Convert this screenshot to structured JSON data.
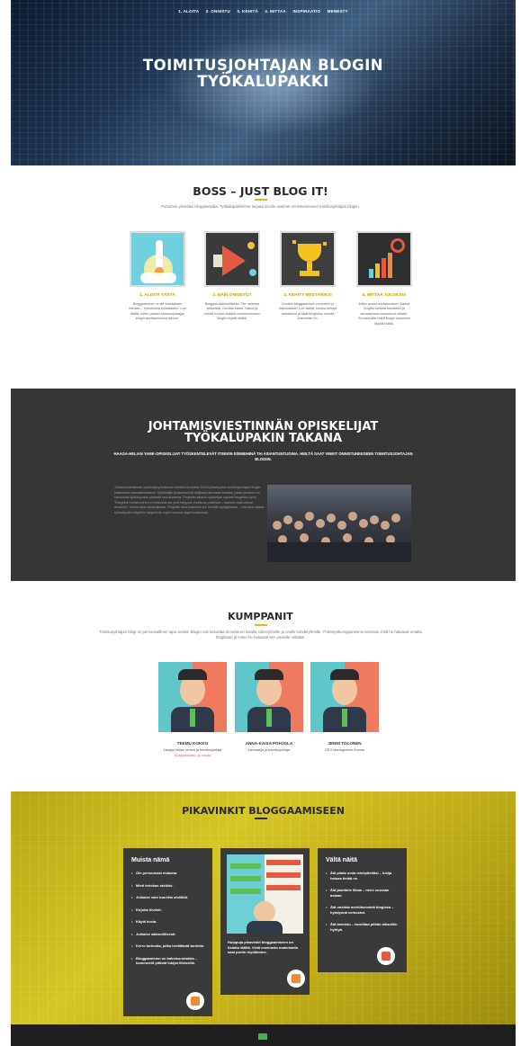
{
  "nav": [
    "1. ALOITA",
    "2. ONNISTU",
    "3. KEHITÄ",
    "4. MITTAA",
    "INSPIRAATIO",
    "MENESTY"
  ],
  "hero": {
    "title_line1": "TOIMITUSJOHTAJAN BLOGIN",
    "title_line2": "TYÖKALUPAKKI"
  },
  "boss": {
    "title": "BOSS – JUST BLOG IT!",
    "subtitle": "Puhuttele yleisöäsi bloggaamalla. Työkalupakkimme tarjoaa sinulle avaimet onnistuneeseen toimitusjohtajan blogiin."
  },
  "tools": [
    {
      "title": "1. ALOITA TÄSTÄ",
      "icon": "rocket-icon",
      "desc": "Bloggaaminen ei ole sosiaalisen median – työkaluista kohtalainen. Lue täältä, miten pääset toimitusjohtajan blogin aloittamisessa alkuun."
    },
    {
      "title": "2. NÄIN ONNISTUT",
      "icon": "megaphone-icon",
      "desc": "Bloggaa säännöllisesti. Tee rakenne selkeäksi. Kuvitus tukee. Nämä ja monta muuta vinkkiä onnistuneeseen blogiin löydät täältä."
    },
    {
      "title": "3. KEHITY MESTARIKSI",
      "icon": "trophy-icon",
      "desc": "Onnistu bloggaamisen perusteet jo hallinnassa? Lue täältä, kuinka kehityt mestariksi ja saat blogistasi entistä enemmän irti."
    },
    {
      "title": "4. MITTAA TULOKSIA",
      "icon": "chart-icon",
      "desc": "Miten arvioit onnistumista? Kaava blogille selkeät tavoitteet ja seuraamaan avainluvut mitatut. Seuraavalla vinkit blogin arvioimiin löydät täältä."
    }
  ],
  "students": {
    "title_line1": "JOHTAMISVIESTINNÄN OPISKELIJAT",
    "title_line2": "TYÖKALUPAKIN TAKANA",
    "subtitle": "HAAGA-HELIAN YAMK-OPISKELIJAT TYÖSKENTELEVÄT ITSEKIN ESIMIEHINÄ TAI ASIANTUNTIJOINA. HEILTÄ SAAT VINKIT ONNISTUNEESEEN TOIMITUSJOHTAJAN BLOGIIN.",
    "text": "Johtamisviestinnän opiskelijaryhmämme kehitteli keväällä 2019 työkalupakin toimitusjohtajan blogin pitämiseen ammattimaisesti. Opiskelijat työskentelivät neljässä pienessä tiimissä, joista jokainen oli vastuussa työkalupakin yhdestä osa-alueesta. Projektin aikana opiskelijat oppivat blogeista hyvin. \"Blogeihin tutustuminen ei hetkessä ole yhtä helppoa, mutta se palkitsee – tuleekin siitä vaivan arvoinen\", kertoo yksi opiskelijoista. Projektin idea kuitenkin tuli monille hyödylliseksi – olisi kiva saada työkalupakin käyttöön laajemmin myös muissa organisaatioissa."
  },
  "partners": {
    "title": "KUMPPANIT",
    "subtitle": "Toimitusjohtajan blogi on persoonallinen tapa viestiä. Blogin voit toteuttaa monella eri tavalla sidosryhmille ja omille kohderyhmille. Yhteistyökumppanimme kertovat, mitä he haluavat omalta blogiltaan ja miten he haluavat sen yleisölle välittää.",
    "people": [
      {
        "name": "TEEMU KOKKO",
        "role": "Haaga-Helian rehtori ja toimitusjohtaja",
        "tag": "#Digitalisaatio, ja muuta"
      },
      {
        "name": "ANNA-KAISA POHJOLA",
        "role": "Lainlaatija ja toimitusjohtaja",
        "tag": ""
      },
      {
        "name": "JENNI TOLONEN",
        "role": "CEO Management Events",
        "tag": ""
      }
    ]
  },
  "tips": {
    "title": "PIKAVINKIT BLOGGAAMISEEN",
    "remember_title": "Muista nämä",
    "remember": [
      "Ole persoonasi mukana.",
      "Mieti tehokas otsikko.",
      "Julkaise vain tuoretta sisältöä.",
      "Kirjoita tiiviisti.",
      "Käytä kuvia.",
      "Julkaise säännöllisesti.",
      "Kerro tarinoita, jotka herättävät tunteita.",
      "Bloggaaminen on kaksisuuntaista – kommentit pitävät lukijat liikkeellä."
    ],
    "middle_text": "Huippuja pikavinkit bloggaamiseen on listattu täältä. Vielä enemmän materiaalia saat portin myötämme.",
    "avoid_title": "Vältä näitä",
    "avoid": [
      "Älä pilata omia mielipiteitäsi – lukija haluaa tietää ne.",
      "Älä jaarittele liikaa – nene suoraan asiaan.",
      "Älä unohda merkitsemistä blogissa – hyödynnä verkostot.",
      "Älä lannistu – tavoittaa pitkän aikavälin hyötyä."
    ]
  }
}
